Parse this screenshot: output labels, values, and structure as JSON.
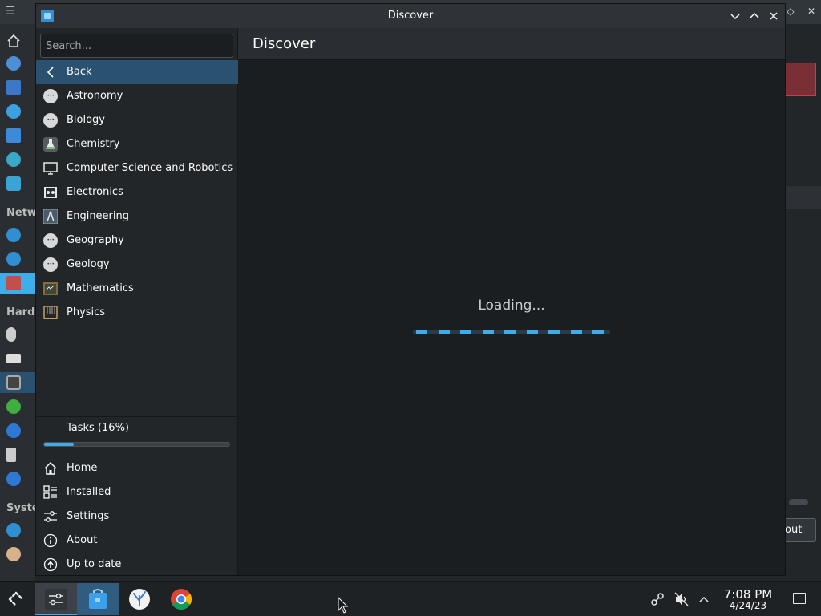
{
  "window": {
    "title": "Discover",
    "controls": {
      "minimize": "⌄",
      "maximize": "⌃",
      "close": "✕"
    }
  },
  "search": {
    "placeholder": "Search..."
  },
  "nav": {
    "back_label": "Back",
    "categories": [
      {
        "label": "Astronomy",
        "icon": "dots-icon"
      },
      {
        "label": "Biology",
        "icon": "dots-icon"
      },
      {
        "label": "Chemistry",
        "icon": "flask-icon"
      },
      {
        "label": "Computer Science and Robotics",
        "icon": "monitor-icon"
      },
      {
        "label": "Electronics",
        "icon": "circuit-icon"
      },
      {
        "label": "Engineering",
        "icon": "compass-icon"
      },
      {
        "label": "Geography",
        "icon": "dots-icon"
      },
      {
        "label": "Geology",
        "icon": "dots-icon"
      },
      {
        "label": "Mathematics",
        "icon": "chalkboard-icon"
      },
      {
        "label": "Physics",
        "icon": "newtons-cradle-icon"
      }
    ]
  },
  "tasks": {
    "label": "Tasks (16%)",
    "progress": 0.16
  },
  "bottom_nav": [
    {
      "label": "Home",
      "icon": "home-icon"
    },
    {
      "label": "Installed",
      "icon": "installed-icon"
    },
    {
      "label": "Settings",
      "icon": "settings-icon"
    },
    {
      "label": "About",
      "icon": "info-icon"
    },
    {
      "label": "Up to date",
      "icon": "update-icon"
    }
  ],
  "main": {
    "title": "Discover",
    "loading_text": "Loading..."
  },
  "background_window": {
    "section_headers": [
      "Netw",
      "Hardv",
      "Syste"
    ],
    "about_button": "out"
  },
  "taskbar": {
    "clock_time": "7:08 PM",
    "clock_date": "4/24/23"
  },
  "colors": {
    "accent": "#3daee9",
    "selection": "#2b5170",
    "window_bg": "#1b1e20",
    "sidebar_bg": "#232629"
  }
}
